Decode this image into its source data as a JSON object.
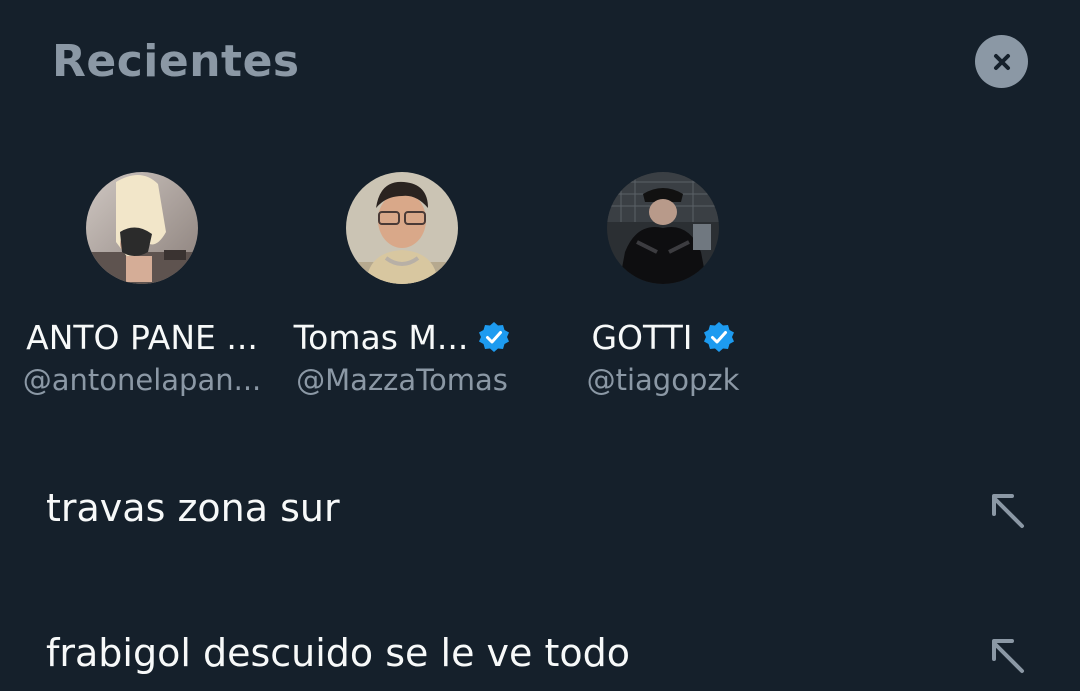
{
  "header": {
    "title": "Recientes",
    "clear_icon": "close-icon"
  },
  "accounts": [
    {
      "name": "ANTO PANE ...",
      "handle": "@antonelapan...",
      "verified": false
    },
    {
      "name": "Tomas M...",
      "handle": "@MazzaTomas",
      "verified": true
    },
    {
      "name": "GOTTI",
      "handle": "@tiagopzk",
      "verified": true
    }
  ],
  "queries": [
    {
      "text": "travas zona sur",
      "icon": "arrow-up-left-icon"
    },
    {
      "text": "frabigol descuido se le ve todo",
      "icon": "arrow-up-left-icon"
    }
  ],
  "colors": {
    "background": "#15202b",
    "primary_text": "#f7f9f9",
    "secondary_text": "#8b98a5",
    "verified_badge": "#1d9bf0"
  }
}
